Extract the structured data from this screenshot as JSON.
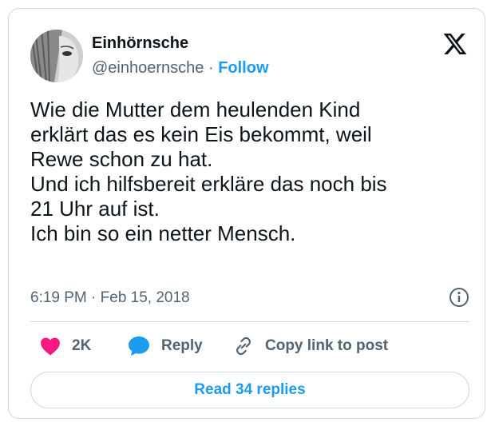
{
  "author": {
    "display_name": "Einhörnsche",
    "handle": "@einhoernsche",
    "separator": "·",
    "follow_label": "Follow"
  },
  "tweet": {
    "lines": [
      "Wie die Mutter dem heulenden Kind",
      "erklärt das es kein Eis bekommt, weil",
      "Rewe schon zu hat.",
      "Und ich hilfsbereit erkläre das noch bis",
      "21 Uhr auf ist.",
      "Ich bin so ein netter Mensch."
    ],
    "timestamp": "6:19 PM · Feb 15, 2018"
  },
  "actions": {
    "like_count": "2K",
    "reply_label": "Reply",
    "copy_label": "Copy link to post"
  },
  "read_replies_label": "Read 34 replies",
  "icons": {
    "logo": "x-logo-icon",
    "info": "info-icon",
    "like": "heart-icon",
    "reply": "speech-bubble-icon",
    "copy": "link-icon"
  },
  "colors": {
    "accent": "#1d9bf0",
    "like": "#f91880",
    "muted": "#536471",
    "text": "#0f1419",
    "border": "#cfd9de"
  }
}
